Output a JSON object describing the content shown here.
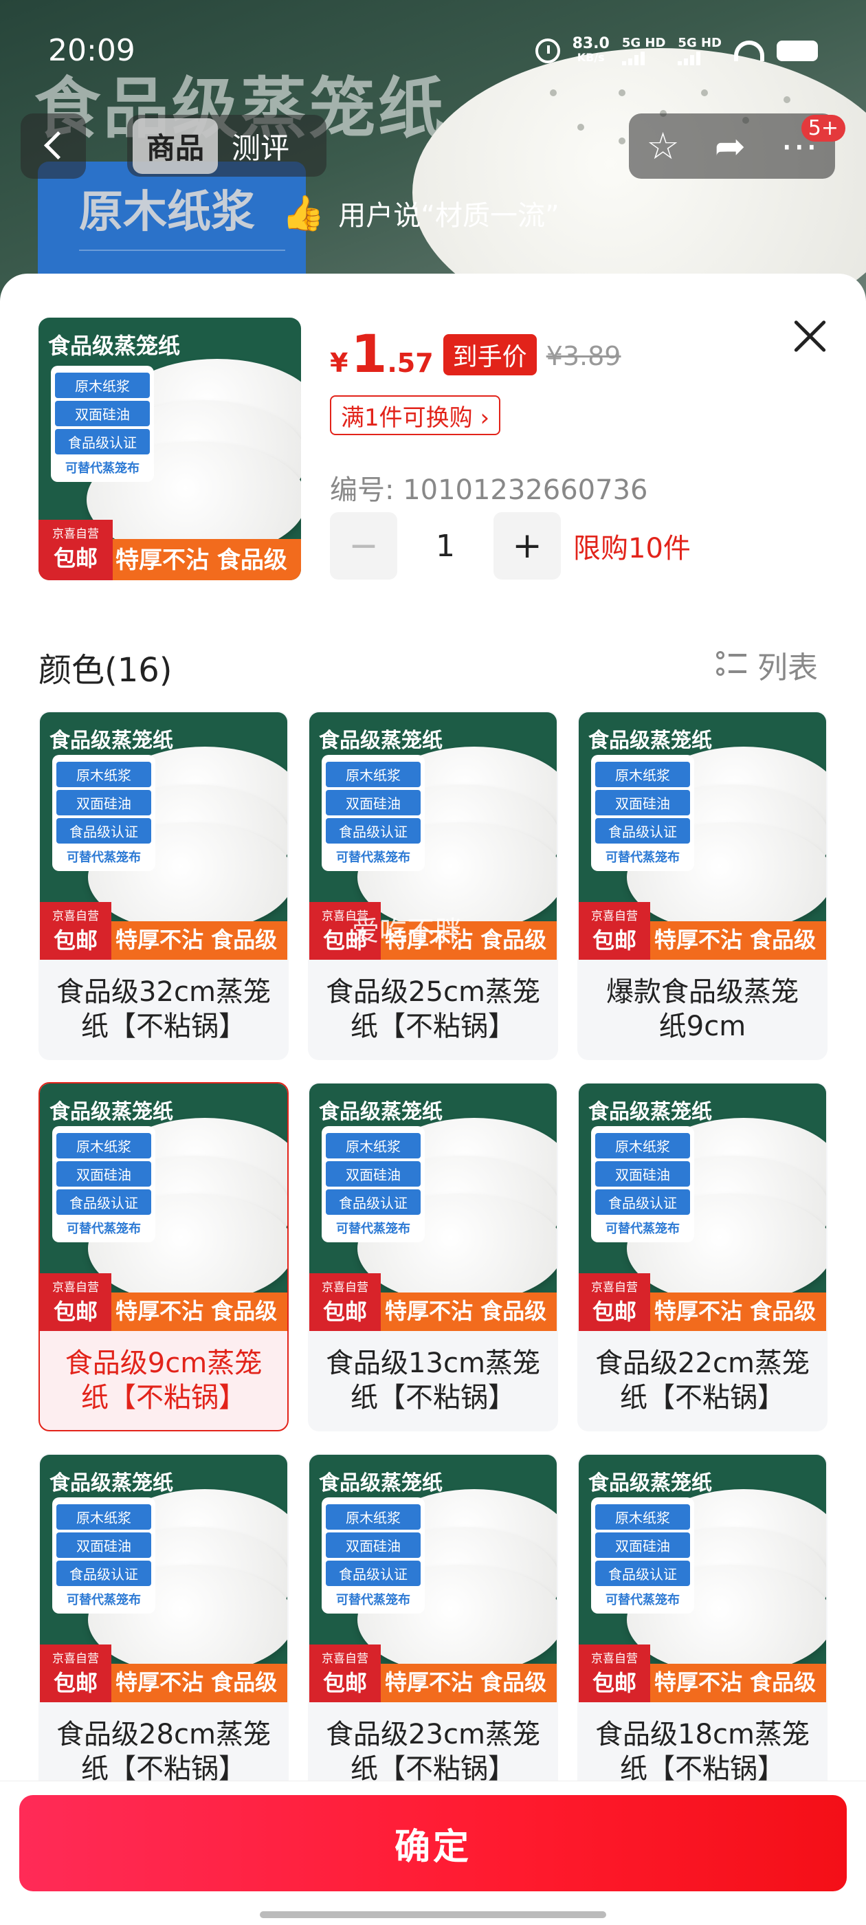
{
  "status_bar": {
    "time": "20:09",
    "net_speed": "83.0",
    "net_unit": "KB/s",
    "sim1": "5G HD",
    "sim2": "5G HD"
  },
  "nav": {
    "tabs": [
      "商品",
      "测评"
    ],
    "active_tab": "商品",
    "badge": "5+"
  },
  "hero": {
    "title": "食品级蒸笼纸",
    "subtitle": "原木纸浆",
    "review_text": "用户说“材质一流”"
  },
  "product_image": {
    "title": "食品级蒸笼纸",
    "features": [
      "原木纸浆",
      "双面硅油",
      "食品级认证"
    ],
    "feature_note": "可替代蒸笼布",
    "self_operated": "京喜自营",
    "free_shipping": "包邮",
    "slogan": "特厚不沾 食品级"
  },
  "sku": {
    "currency": "¥",
    "price_int": "1",
    "price_dec": ".57",
    "price_tag": "到手价",
    "original_price": "¥3.89",
    "promo": "满1件可换购 ›",
    "sku_number": "编号: 10101232660736",
    "quantity": "1",
    "qty_minus": "−",
    "qty_plus": "+",
    "limit": "限购10件"
  },
  "options": {
    "title": "颜色(16)",
    "view_toggle": "列表",
    "items": [
      "食品级32cm蒸笼纸【不粘锅】",
      "食品级25cm蒸笼纸【不粘锅】",
      "爆款食品级蒸笼纸9cm",
      "食品级9cm蒸笼纸【不粘锅】",
      "食品级13cm蒸笼纸【不粘锅】",
      "食品级22cm蒸笼纸【不粘锅】",
      "食品级28cm蒸笼纸【不粘锅】",
      "食品级23cm蒸笼纸【不粘锅】",
      "食品级18cm蒸笼纸【不粘锅】"
    ],
    "selected_index": 3
  },
  "watermark": "爱吃不胖",
  "footer": {
    "confirm": "确定"
  },
  "colors": {
    "accent": "#e2231a",
    "confirm_gradient_start": "#ff2b57",
    "product_green": "#1d5c46"
  }
}
